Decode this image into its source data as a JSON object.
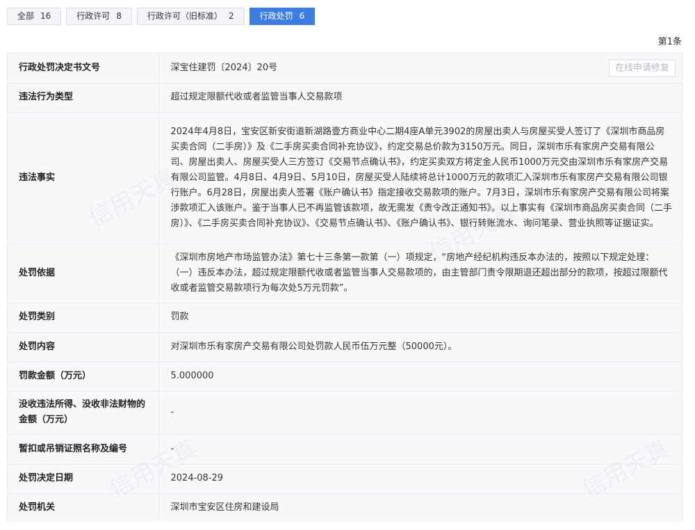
{
  "tabs": [
    {
      "label": "全部",
      "count": "16"
    },
    {
      "label": "行政许可",
      "count": "8"
    },
    {
      "label": "行政许可（旧标准）",
      "count": "2"
    },
    {
      "label": "行政处罚",
      "count": "6"
    }
  ],
  "page_count": "第1条",
  "repair_button": "在线申请修复",
  "rows": [
    {
      "label": "行政处罚决定书文号",
      "value": "深宝住建罚〔2024〕20号"
    },
    {
      "label": "违法行为类型",
      "value": "超过规定限额代收或者监管当事人交易款项"
    },
    {
      "label": "违法事实",
      "value": "2024年4月8日，宝安区新安街道新湖路壹方商业中心二期4座A单元3902的房屋出卖人与房屋买受人签订了《深圳市商品房买卖合同（二手房）》及《二手房买卖合同补充协议》，约定交易总价款为3150万元。同日，深圳市乐有家房产交易有限公司、房屋出卖人、房屋买受人三方签订《交易节点确认书》，约定买卖双方将定金人民币1000万元交由深圳市乐有家房产交易有限公司监管。4月8日、4月9日、5月10日，房屋买受人陆续将总计1000万元的款项汇入深圳市乐有家房产交易有限公司银行账户。6月28日，房屋出卖人签署《账户确认书》指定接收交易款项的账户。7月3日，深圳市乐有家房产交易有限公司将案涉款项汇入该账户。鉴于当事人已不再监管该款项，故无需发《责令改正通知书》。以上事实有《深圳市商品房买卖合同（二手房）》、《二手房买卖合同补充协议》、《交易节点确认书》、《账户确认书》、银行转账流水、询问笔录、营业执照等证据证实。"
    },
    {
      "label": "处罚依据",
      "value": "《深圳市房地产市场监管办法》第七十三条第一款第（一）项规定，“房地产经纪机构违反本办法的，按照以下规定处理：（一）违反本办法，超过规定限额代收或者监管当事人交易款项的，由主管部门责令限期退还超出部分的款项，按超过限额代收或者监管交易款项行为每次处5万元罚款”。"
    },
    {
      "label": "处罚类别",
      "value": "罚款"
    },
    {
      "label": "处罚内容",
      "value": "对深圳市乐有家房产交易有限公司处罚款人民币伍万元整（50000元）。"
    },
    {
      "label": "罚款金额（万元）",
      "value": "5.000000"
    },
    {
      "label": "没收违法所得、没收非法财物的金额（万元）",
      "value": "-"
    },
    {
      "label": "暂扣或吊销证照名称及编号",
      "value": "-"
    },
    {
      "label": "处罚决定日期",
      "value": "2024-08-29"
    },
    {
      "label": "处罚机关",
      "value": "深圳市宝安区住房和建设局"
    }
  ],
  "watermark_text": "信用天真",
  "colors": {
    "accent": "#3e7de0",
    "label_bg": "#f7f8fa"
  }
}
